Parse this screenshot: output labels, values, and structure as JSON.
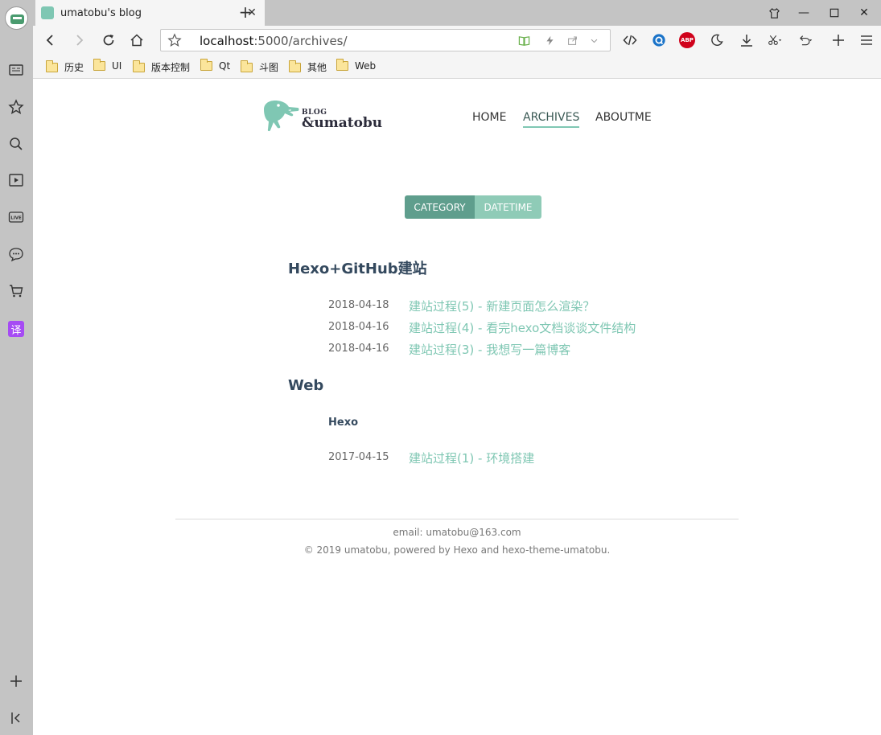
{
  "tab": {
    "title": "umatobu's blog"
  },
  "address": {
    "host": "localhost",
    "path": ":5000/archives/"
  },
  "bookmarks": [
    {
      "label": "历史"
    },
    {
      "label": "UI"
    },
    {
      "label": "版本控制"
    },
    {
      "label": "Qt"
    },
    {
      "label": "斗图"
    },
    {
      "label": "其他"
    },
    {
      "label": "Web"
    }
  ],
  "sidebar": {
    "translate_label": "译"
  },
  "site": {
    "logo_small": "BLOG",
    "logo_big": "&umatobu"
  },
  "nav": [
    {
      "label": "HOME"
    },
    {
      "label": "ARCHIVES",
      "active": true
    },
    {
      "label": "ABOUTME"
    }
  ],
  "toggle": {
    "category": "CATEGORY",
    "datetime": "DATETIME"
  },
  "categories": [
    {
      "title": "Hexo+GitHub建站",
      "posts": [
        {
          "date": "2018-04-18",
          "title": "建站过程(5) - 新建页面怎么渲染？"
        },
        {
          "date": "2018-04-16",
          "title": "建站过程(4) - 看完hexo文档谈谈文件结构"
        },
        {
          "date": "2018-04-16",
          "title": "建站过程(3) - 我想写一篇博客"
        }
      ]
    },
    {
      "title": "Web",
      "subcategory": "Hexo",
      "posts": [
        {
          "date": "2017-04-15",
          "title": "建站过程(1) - 环境搭建"
        }
      ]
    }
  ],
  "footer": {
    "email": "email: umatobu@163.com",
    "copyright": "© 2019 umatobu, powered by Hexo and hexo-theme-umatobu."
  },
  "colors": {
    "accent": "#7fc7b3",
    "accent_dark": "#5f9e8d",
    "heading": "#34495e"
  }
}
